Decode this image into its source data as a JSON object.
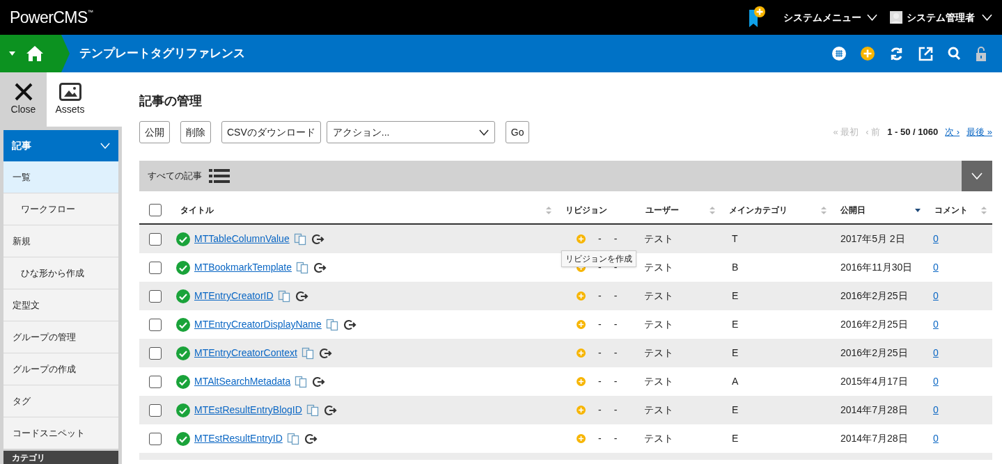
{
  "header": {
    "logo": "PowerCMS",
    "logo_mark": "™",
    "system_menu": "システムメニュー",
    "user": "システム管理者"
  },
  "breadcrumb": {
    "title": "テンプレートタグリファレンス"
  },
  "side_tiles": [
    {
      "label": "Close",
      "kind": "close",
      "selected": true
    },
    {
      "label": "Assets",
      "kind": "assets",
      "selected": false
    }
  ],
  "sidebar": {
    "section": "記事",
    "expanded": true,
    "items": [
      {
        "label": "一覧",
        "selected": true,
        "children": [
          {
            "label": "ワークフロー",
            "selected": false
          }
        ]
      },
      {
        "label": "新規",
        "selected": false,
        "children": [
          {
            "label": "ひな形から作成",
            "selected": false
          }
        ]
      },
      {
        "label": "定型文",
        "selected": false
      },
      {
        "label": "グループの管理",
        "selected": false
      },
      {
        "label": "グループの作成",
        "selected": false
      },
      {
        "label": "タグ",
        "selected": false
      },
      {
        "label": "コードスニペット",
        "selected": false
      }
    ],
    "next_section": "カテゴリ"
  },
  "page_title": "記事の管理",
  "toolbar": {
    "buttons": [
      "公開",
      "削除",
      "CSVのダウンロード"
    ],
    "action_select": "アクション...",
    "go": "Go"
  },
  "pagination": {
    "first": "« 最初",
    "prev": "‹ 前",
    "range": "1 - 50 / 1060",
    "next": "次 ›",
    "last": "最後 »"
  },
  "filter": {
    "label": "すべての記事"
  },
  "table": {
    "select_all": {
      "checked": false
    },
    "columns": [
      {
        "label": "タイトル",
        "sortable": true,
        "sorted": false
      },
      {
        "label": "リビジョン"
      },
      {
        "label": "ユーザー",
        "sortable": true,
        "sorted": false
      },
      {
        "label": "メインカテゴリ",
        "sortable": true,
        "sorted": false
      },
      {
        "label": "公開日",
        "sortable": true,
        "sorted": true
      },
      {
        "label": "コメント",
        "sortable": true,
        "sorted": false
      }
    ],
    "tooltip": "リビジョンを作成",
    "rows": [
      {
        "checked": false,
        "title": "MTTableColumnValue",
        "rev": [
          "-",
          "-"
        ],
        "user": "テスト",
        "category": "T",
        "date": "2017年5月 2日",
        "comments": "0"
      },
      {
        "checked": false,
        "title": "MTBookmarkTemplate",
        "rev": [
          "-",
          "-"
        ],
        "user": "テスト",
        "category": "B",
        "date": "2016年11月30日",
        "comments": "0"
      },
      {
        "checked": false,
        "title": "MTEntryCreatorID",
        "rev": [
          "-",
          "-"
        ],
        "user": "テスト",
        "category": "E",
        "date": "2016年2月25日",
        "comments": "0"
      },
      {
        "checked": false,
        "title": "MTEntryCreatorDisplayName",
        "rev": [
          "-",
          "-"
        ],
        "user": "テスト",
        "category": "E",
        "date": "2016年2月25日",
        "comments": "0"
      },
      {
        "checked": false,
        "title": "MTEntryCreatorContext",
        "rev": [
          "-",
          "-"
        ],
        "user": "テスト",
        "category": "E",
        "date": "2016年2月25日",
        "comments": "0"
      },
      {
        "checked": false,
        "title": "MTAltSearchMetadata",
        "rev": [
          "-",
          "-"
        ],
        "user": "テスト",
        "category": "A",
        "date": "2015年4月17日",
        "comments": "0"
      },
      {
        "checked": false,
        "title": "MTEstResultEntryBlogID",
        "rev": [
          "-",
          "-"
        ],
        "user": "テスト",
        "category": "E",
        "date": "2014年7月28日",
        "comments": "0"
      },
      {
        "checked": false,
        "title": "MTEstResultEntryID",
        "rev": [
          "-",
          "-"
        ],
        "user": "テスト",
        "category": "E",
        "date": "2014年7月28日",
        "comments": "0"
      }
    ]
  }
}
